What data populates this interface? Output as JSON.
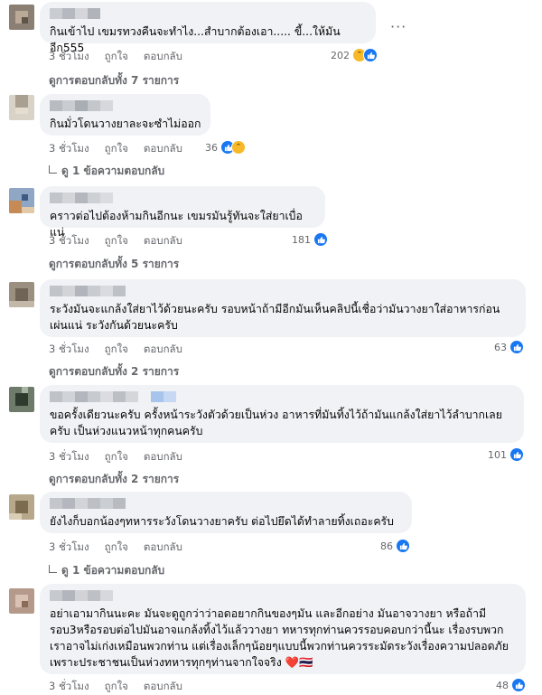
{
  "actions": {
    "like": "ถูกใจ",
    "reply": "ตอบกลับ"
  },
  "more_label": "···",
  "comments": [
    {
      "text": "กินเข้าไป เขมรทวงคืนจะทำไง...สำบากต้องเอา..... ขี้...ให้มันอีก555",
      "time": "3 ชั่วโมง",
      "count": "202",
      "reactions": [
        "haha",
        "like"
      ],
      "replies": "ดูการตอบกลับทั้ง 7 รายการ"
    },
    {
      "text": "กินมั่วโดนวางยาละจะซำไม่ออก",
      "time": "3 ชั่วโมง",
      "count": "36",
      "reactions": [
        "like",
        "haha"
      ],
      "replies": "ดู 1 ข้อความตอบกลับ"
    },
    {
      "text": "คราวต่อไปต้องห้ามกินอีกนะ เขมรมันรู้ทันจะใส่ยาเบื่อแน่",
      "time": "3 ชั่วโมง",
      "count": "181",
      "reactions": [
        "like"
      ],
      "replies": "ดูการตอบกลับทั้ง 5 รายการ"
    },
    {
      "text": "ระวังมันจะแกล้งใส่ยาไว้ด้วยนะครับ รอบหน้าถ้ามีอีกมันเห็นคลิปนี้เชื่อว่ามันวางยาใส่อาหารก่อน\nเผ่นแน่ ระวังกันด้วยนะครับ",
      "time": "3 ชั่วโมง",
      "count": "63",
      "reactions": [
        "like"
      ],
      "replies": "ดูการตอบกลับทั้ง 2 รายการ"
    },
    {
      "text": "ขอครั้งเดียวนะครับ ครั้งหน้าระวังตัวด้วยเป็นห่วง อาหารที่มันทิ้งไว้ถ้ามันแกล้งใส่ยาไว้ลำบากเลย\nครับ เป็นห่วงแนวหน้าทุกคนครับ",
      "time": "3 ชั่วโมง",
      "count": "101",
      "reactions": [
        "like"
      ],
      "replies": "ดูการตอบกลับทั้ง 2 รายการ"
    },
    {
      "text": "ยังไงก็บอกน้องๆทหารระวังโดนวางยาครับ ต่อไปยึดได้ทำลายทิ้งเถอะครับ",
      "time": "3 ชั่วโมง",
      "count": "86",
      "reactions": [
        "like"
      ],
      "replies": "ดู 1 ข้อความตอบกลับ"
    },
    {
      "text": "อย่าเอามากินนะคะ มันจะดูถูกว่าว่าอดอยากกินของๆมัน และอีกอย่าง มันอาจวางยา หรือถ้ามี\nรอบ3หรือรอบต่อไปมันอาจแกล้งทิ้งไว้แล้ววางยา ทหารทุกท่านควรรอบคอบกว่านี้นะ เรื่องรบพวก\nเราอาจไม่เก่งเหมือนพวกท่าน แต่เรื่องเล็กๆน้อยๆแบบนี้พวกท่านควรระมัดระวังเรื่องความปลอดภัย\nเพราะประชาชนเป็นห่วงทหารทุกๆท่านจากใจจริง ❤️🇹🇭",
      "time": "3 ชั่วโมง",
      "count": "48",
      "reactions": [
        "like"
      ],
      "replies": ""
    }
  ],
  "colors": {
    "bubble": "#f0f2f5",
    "like": "#1877f2",
    "haha": "#f7b928",
    "meta": "#65676b"
  }
}
